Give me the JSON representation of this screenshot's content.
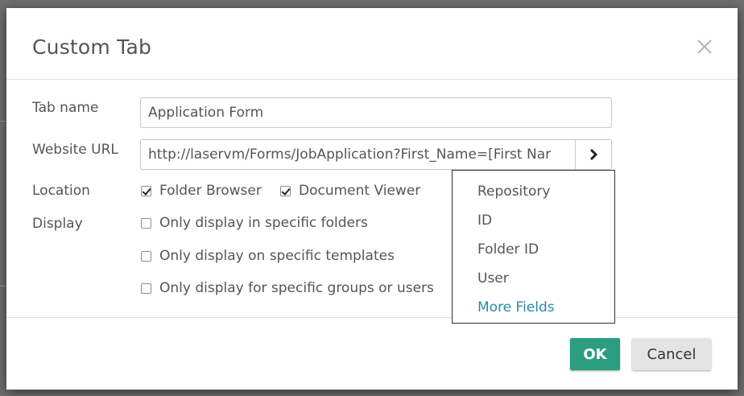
{
  "dialog": {
    "title": "Custom Tab",
    "close_icon": "close-icon"
  },
  "form": {
    "tab_name": {
      "label": "Tab name",
      "value": "Application Form"
    },
    "website_url": {
      "label": "Website URL",
      "value": "http://laservm/Forms/JobApplication?First_Name=[First Nar",
      "go_icon": "chevron-right-icon"
    },
    "location": {
      "label": "Location",
      "options": [
        {
          "label": "Folder Browser",
          "checked": true
        },
        {
          "label": "Document Viewer",
          "checked": true
        }
      ]
    },
    "display": {
      "label": "Display",
      "options": [
        {
          "label": "Only display in specific folders",
          "checked": false
        },
        {
          "label": "Only display on specific templates",
          "checked": false
        },
        {
          "label": "Only display for specific groups or users",
          "checked": false
        }
      ]
    }
  },
  "token_menu": {
    "items": [
      "Repository",
      "ID",
      "Folder ID",
      "User"
    ],
    "more_label": "More Fields"
  },
  "footer": {
    "ok_label": "OK",
    "cancel_label": "Cancel"
  },
  "colors": {
    "ok_button": "#2b9e80",
    "link": "#2a8aa6",
    "text": "#555555"
  }
}
